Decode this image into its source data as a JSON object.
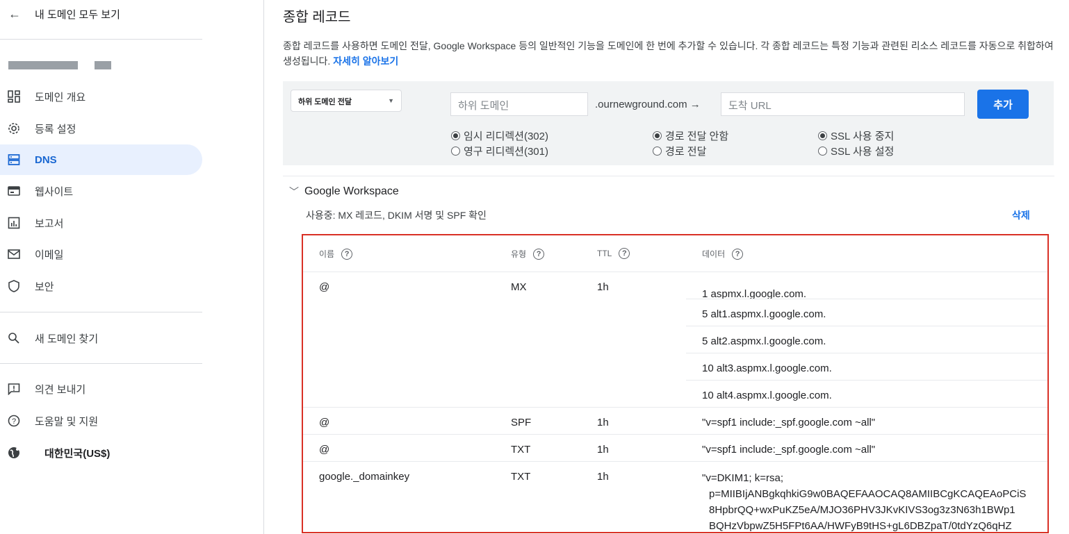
{
  "sidebar": {
    "back_label": "내 도메인 모두 보기",
    "items": [
      {
        "label": "도메인 개요",
        "icon": "dashboard-icon"
      },
      {
        "label": "등록 설정",
        "icon": "gear-icon"
      },
      {
        "label": "DNS",
        "icon": "dns-icon"
      },
      {
        "label": "웹사이트",
        "icon": "web-icon"
      },
      {
        "label": "보고서",
        "icon": "chart-icon"
      },
      {
        "label": "이메일",
        "icon": "mail-icon"
      },
      {
        "label": "보안",
        "icon": "shield-icon"
      }
    ],
    "find_domain": "새 도메인 찾기",
    "feedback": "의견 보내기",
    "help": "도움말 및 지원",
    "region": "대한민국(US$)"
  },
  "main": {
    "title": "종합 레코드",
    "description": "종합 레코드를 사용하면 도메인 전달, Google Workspace 등의 일반적인 기능을 도메인에 한 번에 추가할 수 있습니다. 각 종합 레코드는 특정 기능과 관련된 리소스 레코드를 자동으로 취합하여 생성됩니다. ",
    "learn_more": "자세히 알아보기",
    "form": {
      "type_select": "하위 도메인 전달",
      "subdomain_placeholder": "하위 도메인",
      "suffix": ".ournewground.com →",
      "url_placeholder": "도착 URL",
      "add_button": "추가",
      "redirect_temp": "임시 리디렉션(302)",
      "redirect_perm": "영구 리디렉션(301)",
      "path_off": "경로 전달 안함",
      "path_on": "경로 전달",
      "ssl_off": "SSL 사용 중지",
      "ssl_on": "SSL 사용 설정"
    },
    "workspace": {
      "title": "Google Workspace",
      "usage": "사용중: MX 레코드, DKIM 서명 및 SPF 확인",
      "delete": "삭제"
    },
    "table": {
      "headers": {
        "name": "이름",
        "type": "유형",
        "ttl": "TTL",
        "data": "데이터"
      },
      "mx": {
        "name": "@",
        "type": "MX",
        "ttl": "1h",
        "data": [
          "1 aspmx.l.google.com.",
          "5 alt1.aspmx.l.google.com.",
          "5 alt2.aspmx.l.google.com.",
          "10 alt3.aspmx.l.google.com.",
          "10 alt4.aspmx.l.google.com."
        ]
      },
      "spf": {
        "name": "@",
        "type": "SPF",
        "ttl": "1h",
        "data": "\"v=spf1 include:_spf.google.com ~all\""
      },
      "txt": {
        "name": "@",
        "type": "TXT",
        "ttl": "1h",
        "data": "\"v=spf1 include:_spf.google.com ~all\""
      },
      "dkim": {
        "name": "google._domainkey",
        "type": "TXT",
        "ttl": "1h",
        "lines": [
          "\"v=DKIM1; k=rsa;",
          "p=MIIBIjANBgkqhkiG9w0BAQEFAAOCAQ8AMIIBCgKCAQEAoPCiS",
          "8HpbrQQ+wxPuKZ5eA/MJO36PHV3JKvKIVS3og3z3N63h1BWp1",
          "BQHzVbpwZ5H5FPt6AA/HWFyB9tHS+gL6DBZpaT/0tdYzQ6qHZ"
        ]
      }
    }
  }
}
